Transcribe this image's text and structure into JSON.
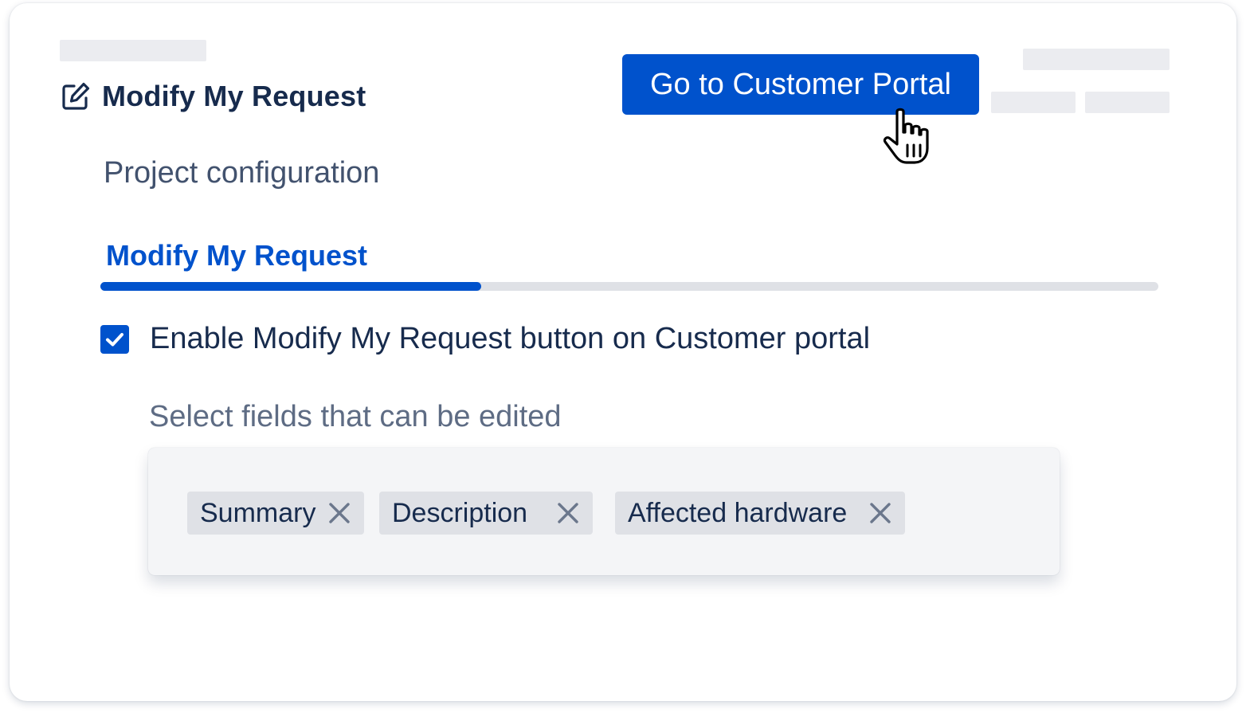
{
  "header": {
    "title": "Modify My Request",
    "title_icon": "edit-icon",
    "portal_button_label": "Go to Customer Portal"
  },
  "config": {
    "section_title": "Project configuration",
    "active_tab": "Modify My Request",
    "tab_progress_fraction": 0.36
  },
  "settings": {
    "enable_checkbox_checked": true,
    "enable_label": "Enable Modify My Request button on Customer portal",
    "fields_label": "Select fields that can be edited",
    "selected_fields": [
      {
        "label": "Summary",
        "remove_icon": "close-icon"
      },
      {
        "label": "Description",
        "remove_icon": "close-icon"
      },
      {
        "label": "Affected hardware",
        "remove_icon": "close-icon"
      }
    ]
  },
  "colors": {
    "primary": "#0052cc",
    "text_dark": "#172b4d",
    "text_muted": "#5e6c84",
    "skeleton": "#ebecf0",
    "tag_bg": "#dfe1e6"
  }
}
